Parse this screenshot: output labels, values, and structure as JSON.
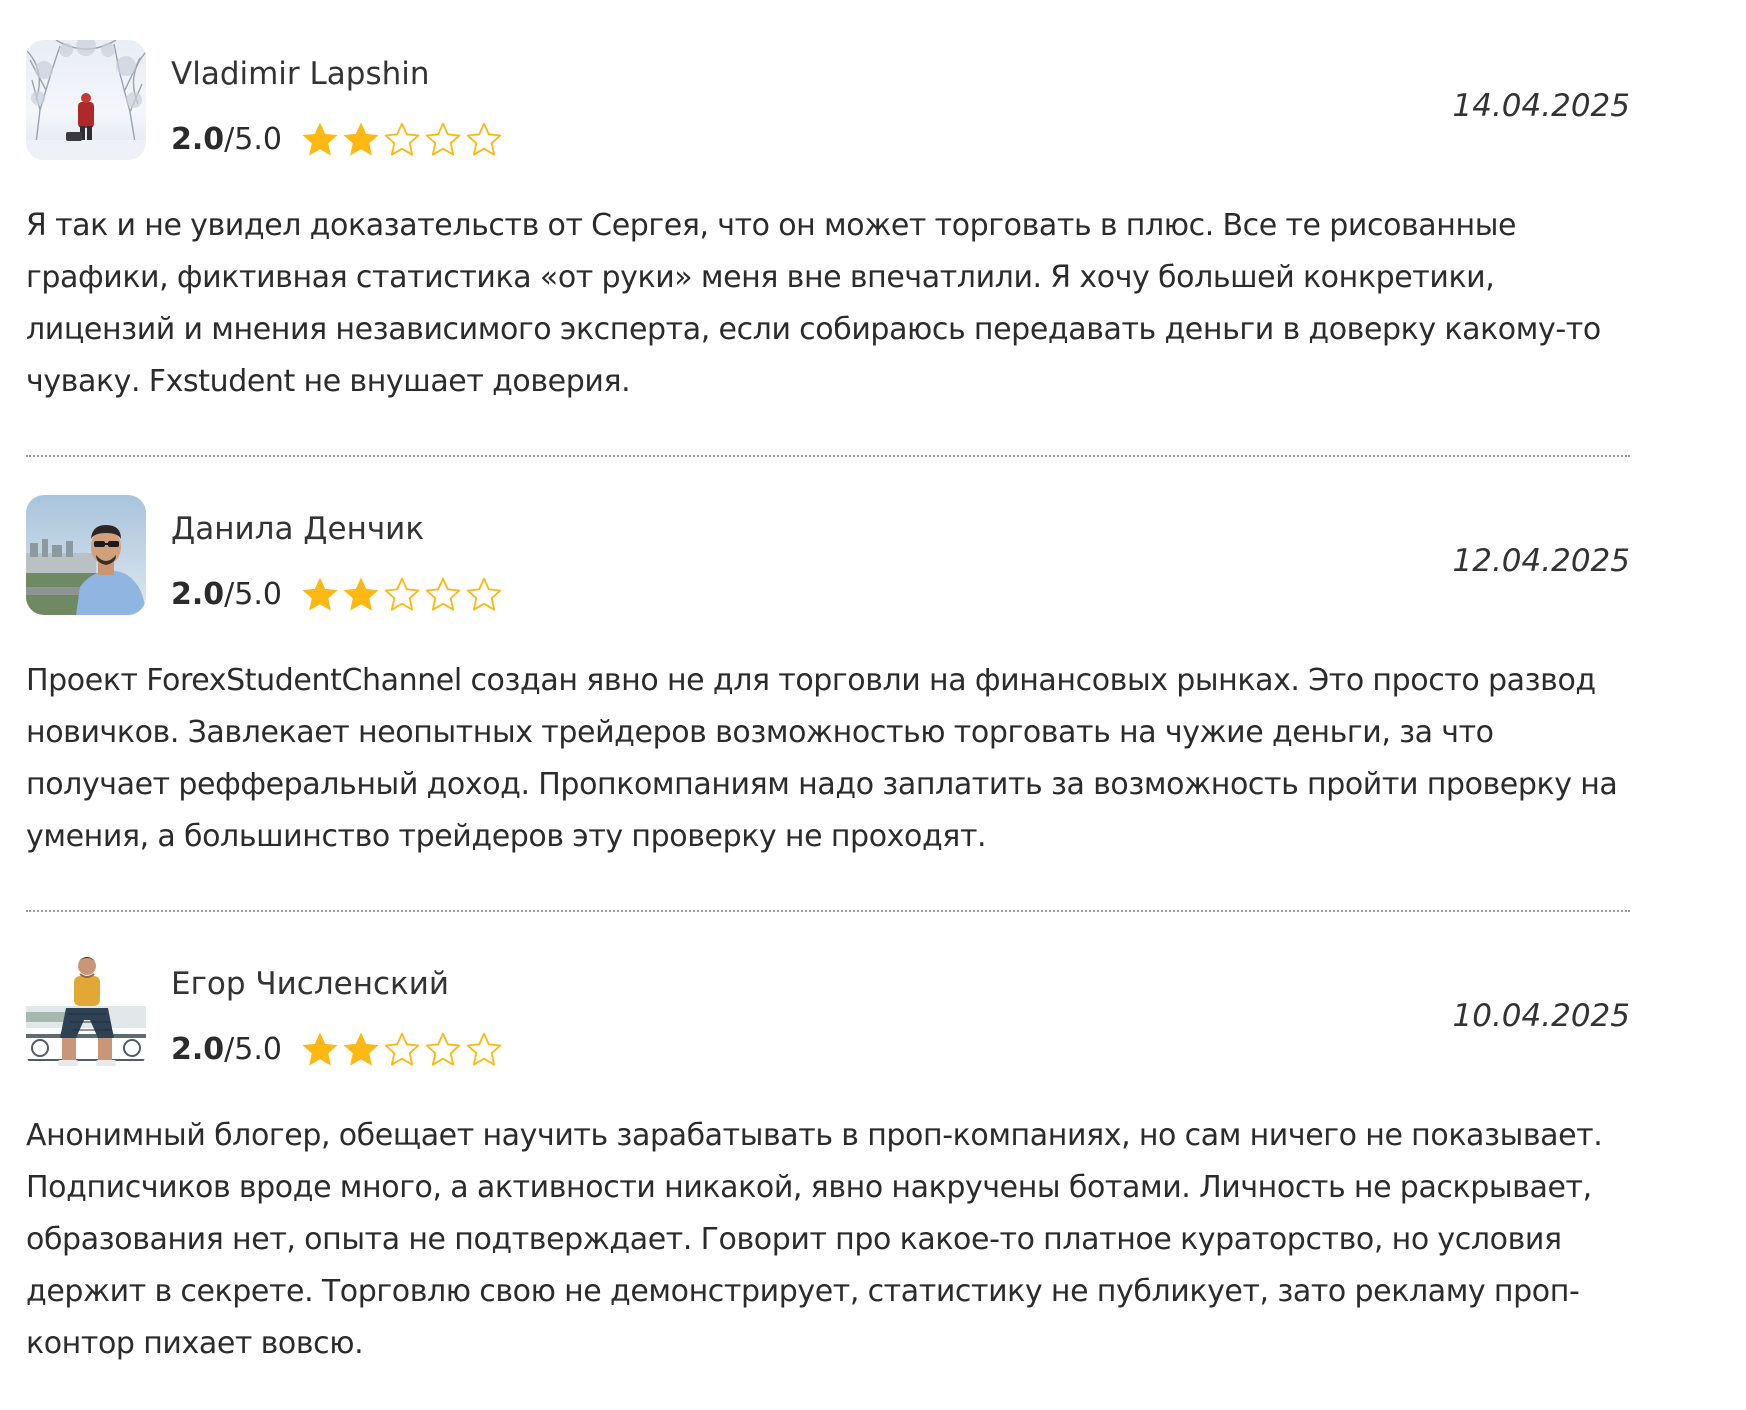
{
  "accent": {
    "star_filled": "#FDB813",
    "star_outline": "#FDB813"
  },
  "reviews": [
    {
      "author": "Vladimir Lapshin",
      "score_value": "2.0",
      "score_max": "/5.0",
      "stars_filled": 2,
      "stars_total": 5,
      "date": "14.04.2025",
      "text": "Я так и не увидел доказательств от Сергея, что он может торговать в плюс. Все те рисованные графики, фиктивная статистика «от руки» меня вне впечатлили. Я хочу большей конкретики, лицензий и мнения независимого эксперта, если собираюсь передавать деньги в доверку какому-то чуваку. Fxstudent не внушает доверия."
    },
    {
      "author": "Данила Денчик",
      "score_value": "2.0",
      "score_max": "/5.0",
      "stars_filled": 2,
      "stars_total": 5,
      "date": "12.04.2025",
      "text": "Проект ForexStudentChannel создан явно не для торговли на финансовых рынках. Это просто развод новичков. Завлекает неопытных трейдеров возможностью торговать на чужие деньги, за что получает рефферальный доход. Пропкомпаниям надо заплатить за возможность пройти проверку на умения, а большинство трейдеров эту проверку не проходят."
    },
    {
      "author": "Егор Численский",
      "score_value": "2.0",
      "score_max": "/5.0",
      "stars_filled": 2,
      "stars_total": 5,
      "date": "10.04.2025",
      "text": "Анонимный блогер, обещает научить зарабатывать в проп-компаниях, но сам ничего не показывает. Подписчиков вроде много, а активности никакой, явно накручены ботами. Личность не раскрывает, образования нет, опыта не подтверждает. Говорит про какое-то платное кураторство, но условия держит в секрете. Торговлю свою не демонстрирует, статистику не публикует, зато рекламу проп-контор пихает вовсю."
    }
  ]
}
